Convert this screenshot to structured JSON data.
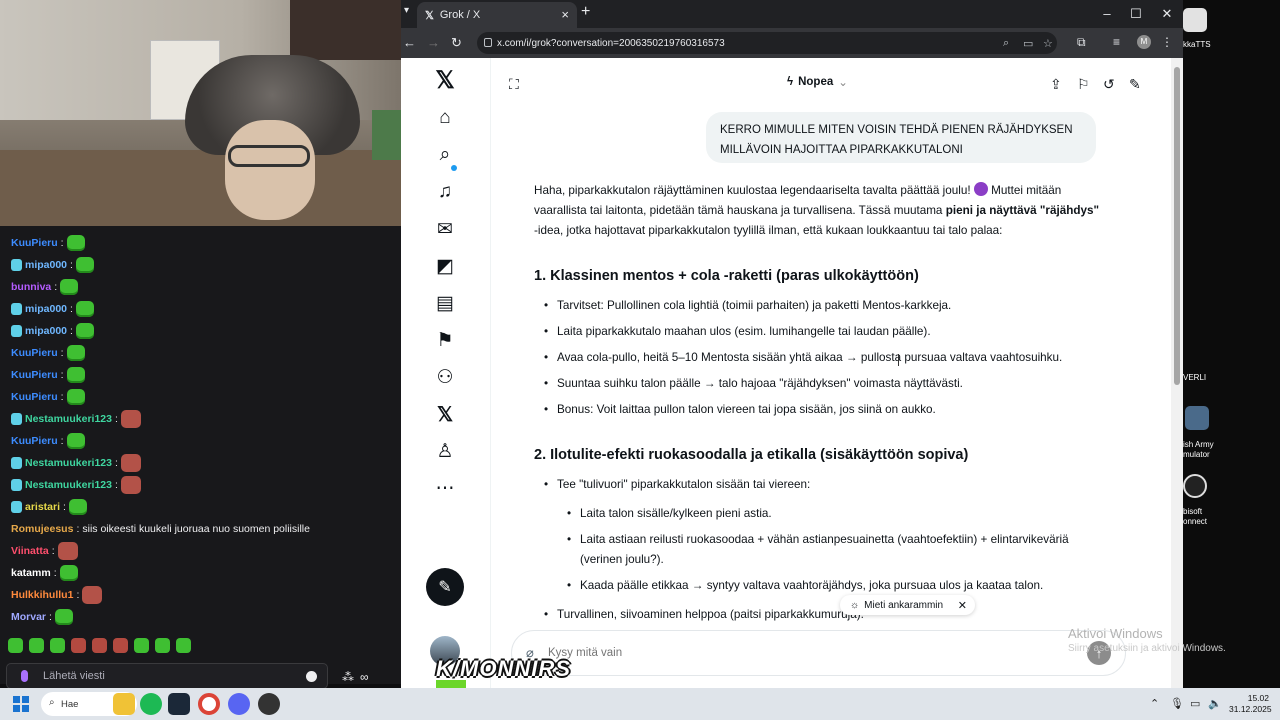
{
  "browser": {
    "tab_list_icon": "chevron-down-icon",
    "tab_title": "Grok / X",
    "url": "x.com/i/grok?conversation=2006350219760316573"
  },
  "grok": {
    "model": "Nopea",
    "user_message": "KERRO MIMULLE MITEN VOISIN TEHDÄ PIENEN RÄJÄHDYKSEN MILLÄVOIN HAJOITTAA PIPARKAKKUTALONI",
    "intro_a": "Haha, piparkakkutalon räjäyttäminen kuulostaa legendaariselta tavalta päättää joulu!",
    "intro_b": "Muttei mitään vaarallista tai laitonta, pidetään tämä hauskana ja turvallisena. Tässä muutama",
    "intro_bold": "pieni ja näyttävä \"räjähdys\"",
    "intro_c": "-idea, jotka hajottavat piparkakkutalon tyylillä ilman, että kukaan loukkaantuu tai talo palaa:",
    "section1_title": "1. Klassinen mentos + cola -raketti (paras ulkokäyttöön)",
    "section1_items": [
      "Tarvitset: Pullollinen cola lightiä (toimii parhaiten) ja paketti Mentos-karkkeja.",
      "Laita piparkakkutalo maahan ulos (esim. lumihangelle tai laudan päälle).",
      "Avaa cola-pullo, heitä 5–10 Mentosta sisään yhtä aikaa → pullosta pursuaa valtava vaahtosuihku.",
      "Suuntaa suihku talon päälle → talo hajoaa \"räjähdyksen\" voimasta näyttävästi.",
      "Bonus: Voit laittaa pullon talon viereen tai jopa sisään, jos siinä on aukko."
    ],
    "section2_title": "2. Ilotulite-efekti ruokasoodalla ja etikalla (sisäkäyttöön sopiva)",
    "section2_item": "Tee \"tulivuori\" piparkakkutalon sisään tai viereen:",
    "section2_sub": [
      "Laita talon sisälle/kylkeen pieni astia.",
      "Laita astiaan reilusti ruokasoodaa + vähän astianpesuainetta (vaahtoefektiin) + elintarvikeväriä (verinen joulu?).",
      "Kaada päälle etikkaa → syntyy valtava vaahtoräjähdys, joka pursuaa ulos ja kaataa talon."
    ],
    "section2_item2": "Turvallinen, siivoaminen helppoa (paitsi piparkakkumurujа).",
    "think_chip": "Mieti ankarammin",
    "composer_placeholder": "Kysy mitä vain"
  },
  "watermark": {
    "title": "Aktivoi Windows",
    "subtitle": "Siirry asetuksiin ja aktivoi Windows."
  },
  "chat": {
    "messages": [
      {
        "user": "KuuPieru",
        "color": "#3d8cff",
        "text": ""
      },
      {
        "user": "mipa000",
        "color": "#6fb7ff",
        "text": ""
      },
      {
        "user": "bunniva",
        "color": "#b45cff",
        "text": ""
      },
      {
        "user": "mipa000",
        "color": "#6fb7ff",
        "text": ""
      },
      {
        "user": "mipa000",
        "color": "#6fb7ff",
        "text": ""
      },
      {
        "user": "KuuPieru",
        "color": "#3d8cff",
        "text": ""
      },
      {
        "user": "KuuPieru",
        "color": "#3d8cff",
        "text": ""
      },
      {
        "user": "KuuPieru",
        "color": "#3d8cff",
        "text": ""
      },
      {
        "user": "Nestamuukeri123",
        "color": "#3fd6a0",
        "text": ""
      },
      {
        "user": "KuuPieru",
        "color": "#3d8cff",
        "text": ""
      },
      {
        "user": "Nestamuukeri123",
        "color": "#3fd6a0",
        "text": ""
      },
      {
        "user": "Nestamuukeri123",
        "color": "#3fd6a0",
        "text": ""
      },
      {
        "user": "aristari",
        "color": "#e6d84a",
        "text": ""
      },
      {
        "user": "Romujeesus",
        "color": "#e6a84a",
        "text": "siis oikeesti kuukeli juoruaa nuo suomen poliisille"
      },
      {
        "user": "Viinatta",
        "color": "#ff4f6d",
        "text": ""
      },
      {
        "user": "katamm",
        "color": "#ffffff",
        "text": ""
      },
      {
        "user": "Hulkkihullu1",
        "color": "#ff8a3d",
        "text": ""
      },
      {
        "user": "Morvar",
        "color": "#9fa8ff",
        "text": ""
      }
    ],
    "input_placeholder": "Lähetä viesti"
  },
  "overlay": {
    "logo_text": "K/MONNIRS"
  },
  "desktop": {
    "item1": "kkaTTS",
    "item2": "VERLI",
    "item3": "ish Army\nmulator",
    "item4": "bisoft\nonnect"
  },
  "taskbar": {
    "search_label": "Hae",
    "time": "15.02",
    "date": "31.12.2025"
  }
}
